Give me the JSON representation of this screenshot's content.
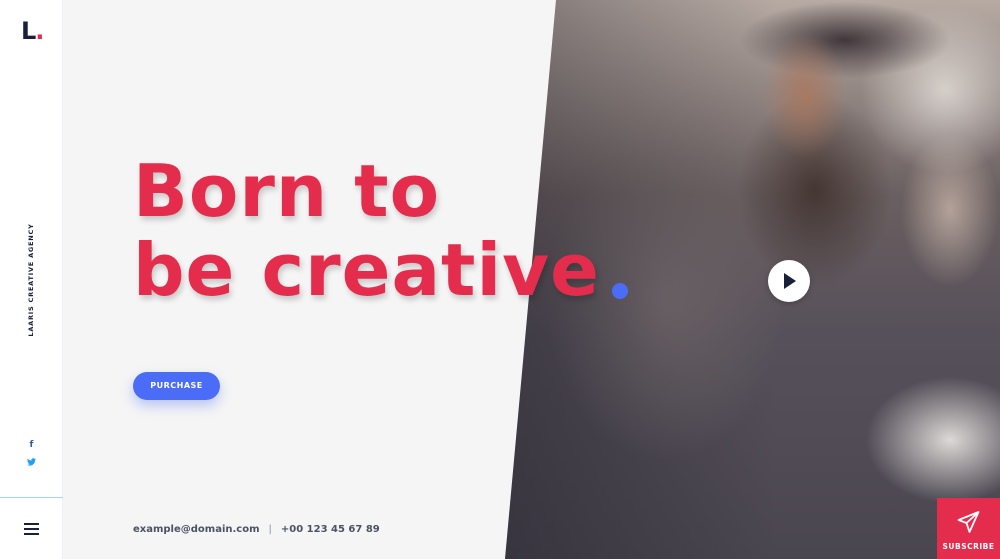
{
  "brand": {
    "logo_letter": "L",
    "logo_dot": ".",
    "agency_name": "LAARIS CREATIVE AGENCY"
  },
  "social": [
    {
      "icon": "facebook-icon",
      "glyph": "f"
    },
    {
      "icon": "twitter-icon",
      "glyph": "🐦"
    }
  ],
  "hero": {
    "headline_line1": "Born to",
    "headline_line2": "be creative",
    "purchase_label": "PURCHASE",
    "play_icon": "play-icon"
  },
  "contact": {
    "email": "example@domain.com",
    "separator": "|",
    "phone": "+00 123 45 67 89"
  },
  "subscribe": {
    "label": "SUBSCRIBE",
    "icon": "paper-plane-icon"
  },
  "colors": {
    "accent_red": "#e42c4c",
    "accent_blue": "#4a6cf7",
    "navy": "#1a1f3a",
    "background": "#f5f5f5"
  }
}
